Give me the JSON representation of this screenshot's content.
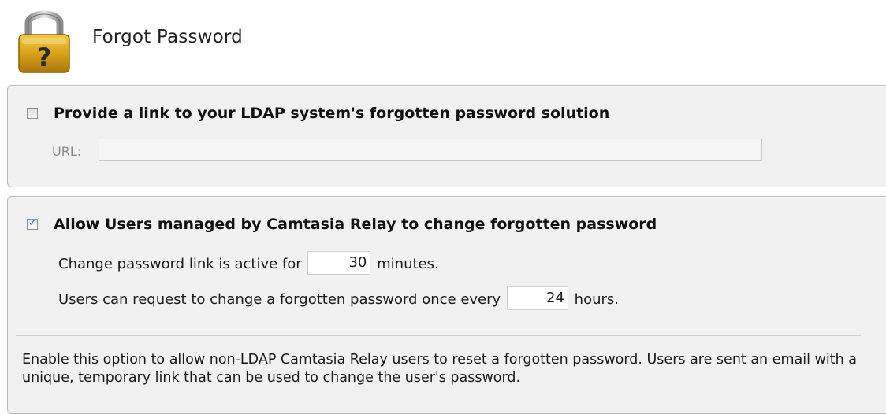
{
  "header": {
    "title": "Forgot Password",
    "icon": "padlock-question-icon",
    "icon_colors": {
      "body": "#d9a21b",
      "shackle": "#b5b5b5",
      "mark": "#2a2a2a"
    }
  },
  "ldap_option": {
    "checked": false,
    "label": "Provide a link to your LDAP system's forgotten password solution",
    "url_label": "URL:",
    "url_value": ""
  },
  "relay_option": {
    "checked": true,
    "label": "Allow Users managed by Camtasia Relay to change forgotten password",
    "link_active_prefix": "Change password link is active for",
    "link_active_value": "30",
    "link_active_suffix": "minutes.",
    "request_prefix": "Users can request to change a forgotten password once every",
    "request_value": "24",
    "request_suffix": "hours.",
    "help_text": "Enable this option to allow non-LDAP Camtasia Relay users to reset a forgotten password. Users are sent an email with a unique, temporary link that can be used to change the user's password."
  },
  "colors": {
    "panel_background": "#f1f1f1",
    "panel_border": "#b9b9b9",
    "checkmark": "#2a5fc1"
  }
}
